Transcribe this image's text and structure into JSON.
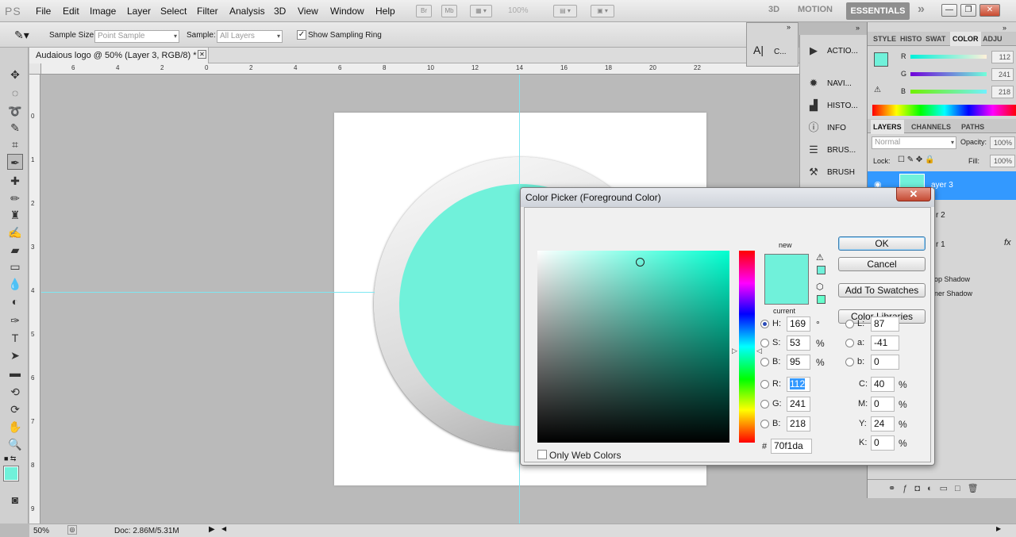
{
  "app": {
    "logo": "PS"
  },
  "menu": [
    "File",
    "Edit",
    "Image",
    "Layer",
    "Select",
    "Filter",
    "Analysis",
    "3D",
    "View",
    "Window",
    "Help"
  ],
  "appbar": {
    "zoom": "100%",
    "tab_br": "Br",
    "tab_mb": "Mb"
  },
  "workspace": {
    "w3d": "3D",
    "motion": "MOTION",
    "essentials": "ESSENTIALS",
    "more": "»"
  },
  "options": {
    "sample_size_label": "Sample Size:",
    "sample_size_value": "Point Sample",
    "sample_label": "Sample:",
    "sample_value": "All Layers",
    "show_ring_label": "Show Sampling Ring"
  },
  "document": {
    "tab_title": "Audaious logo @ 50% (Layer 3, RGB/8) *"
  },
  "status": {
    "zoom": "50%",
    "doc_info": "Doc: 2.86M/5.31M"
  },
  "collapsed_panel": {
    "label": "C..."
  },
  "icon_panel": [
    {
      "icon": "actions-icon",
      "label": "ACTIO..."
    },
    {
      "icon": "navigator-icon",
      "label": "NAVI..."
    },
    {
      "icon": "histogram-icon",
      "label": "HISTO..."
    },
    {
      "icon": "info-icon",
      "label": "INFO"
    },
    {
      "icon": "brush-presets-icon",
      "label": "BRUS..."
    },
    {
      "icon": "brush-icon",
      "label": "BRUSH"
    }
  ],
  "right_panel": {
    "tabs": [
      "STYLE",
      "HISTO",
      "SWAT",
      "COLOR",
      "ADJU"
    ],
    "color": {
      "r_label": "R",
      "g_label": "G",
      "b_label": "B",
      "r": "112",
      "g": "241",
      "b": "218",
      "swatch": "#70f1da"
    },
    "layer_tabs": [
      "LAYERS",
      "CHANNELS",
      "PATHS"
    ],
    "blend_mode": "Normal",
    "opacity_label": "Opacity:",
    "opacity": "100%",
    "lock_label": "Lock:",
    "fill_label": "Fill:",
    "fill": "100%",
    "layers": [
      {
        "name": "ayer 3"
      },
      {
        "name": "r 2"
      },
      {
        "name": "r 1",
        "fx": "fx"
      }
    ],
    "effects": [
      "op Shadow",
      "ner Shadow"
    ]
  },
  "color_picker": {
    "title": "Color Picker (Foreground Color)",
    "close": "✕",
    "new_label": "new",
    "current_label": "current",
    "ok": "OK",
    "cancel": "Cancel",
    "add_swatches": "Add To Swatches",
    "color_libraries": "Color Libraries",
    "only_web_colors": "Only Web Colors",
    "hsb": {
      "h": {
        "label": "H:",
        "value": "169",
        "unit": "°"
      },
      "s": {
        "label": "S:",
        "value": "53",
        "unit": "%"
      },
      "b": {
        "label": "B:",
        "value": "95",
        "unit": "%"
      }
    },
    "rgb": {
      "r": {
        "label": "R:",
        "value": "112"
      },
      "g": {
        "label": "G:",
        "value": "241"
      },
      "b": {
        "label": "B:",
        "value": "218"
      }
    },
    "lab": {
      "l": {
        "label": "L:",
        "value": "87"
      },
      "a": {
        "label": "a:",
        "value": "-41"
      },
      "b": {
        "label": "b:",
        "value": "0"
      }
    },
    "cmyk": {
      "c": {
        "label": "C:",
        "value": "40",
        "unit": "%"
      },
      "m": {
        "label": "M:",
        "value": "0",
        "unit": "%"
      },
      "y": {
        "label": "Y:",
        "value": "24",
        "unit": "%"
      },
      "k": {
        "label": "K:",
        "value": "0",
        "unit": "%"
      }
    },
    "hex_label": "#",
    "hex": "70f1da",
    "color": "#70f1da"
  },
  "ruler_h": [
    "6",
    "4",
    "2",
    "0",
    "2",
    "4",
    "6",
    "8",
    "10",
    "12",
    "14",
    "16",
    "18",
    "20",
    "22"
  ],
  "ruler_v": [
    "0",
    "1",
    "2",
    "3",
    "4",
    "5",
    "6",
    "7",
    "8",
    "9"
  ]
}
